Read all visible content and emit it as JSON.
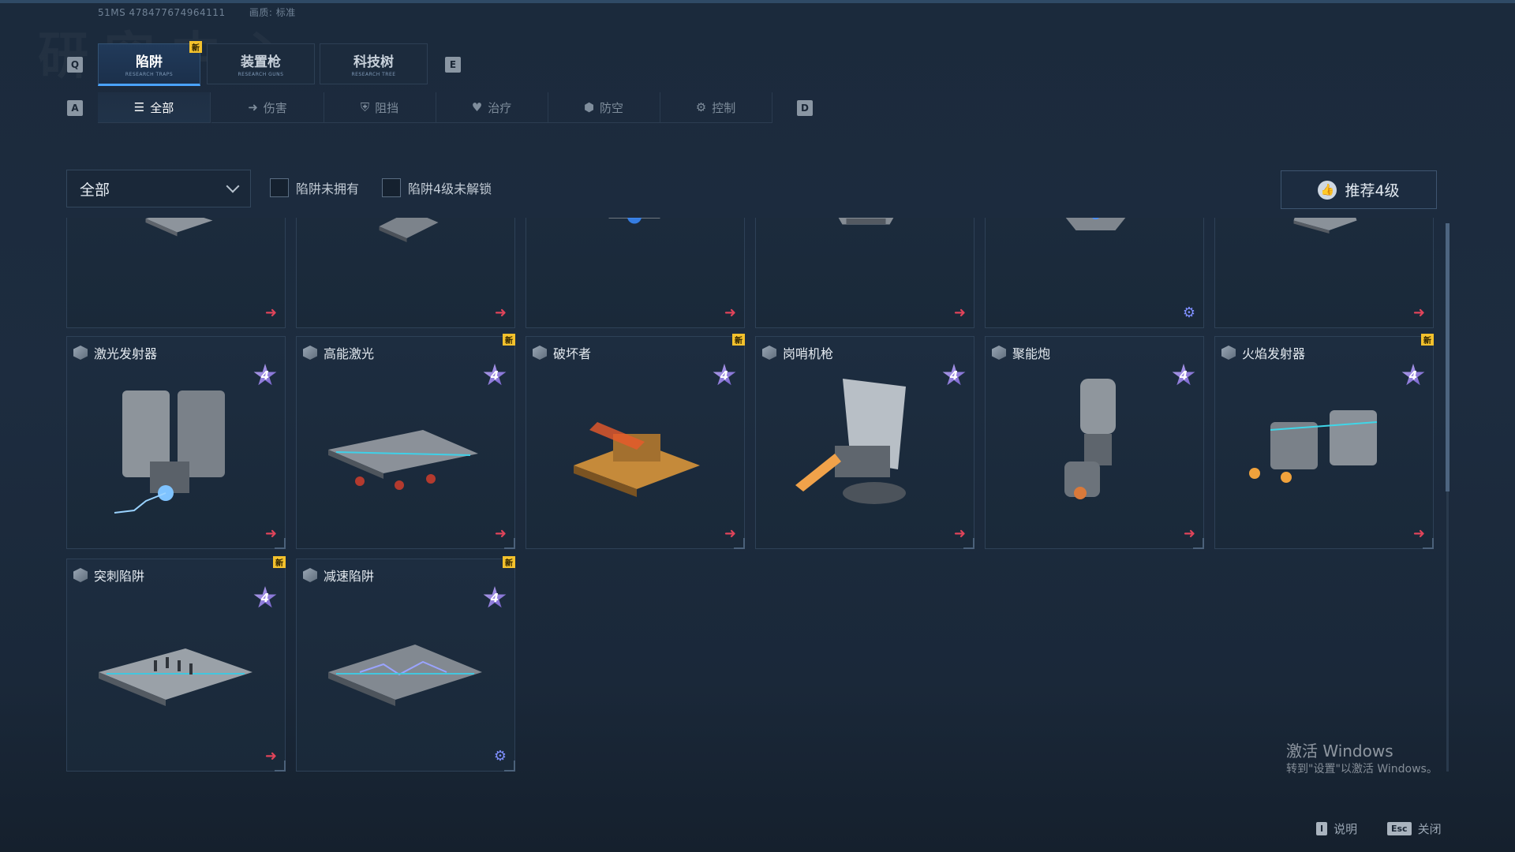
{
  "build_info": {
    "version": "51MS 478477674964111",
    "quality": "画质: 标准"
  },
  "watermark": "研究中心",
  "keys": {
    "prev_main": "Q",
    "next_main": "E",
    "prev_sub": "A",
    "next_sub": "D"
  },
  "main_tabs": [
    {
      "label": "陷阱",
      "sub": "RESEARCH TRAPS",
      "active": true,
      "new": "新"
    },
    {
      "label": "装置枪",
      "sub": "RESEARCH GUNS",
      "active": false
    },
    {
      "label": "科技树",
      "sub": "RESEARCH TREE",
      "active": false
    }
  ],
  "sub_tabs": [
    {
      "label": "全部",
      "icon": "list-icon",
      "active": true
    },
    {
      "label": "伤害",
      "icon": "arrow-right-icon"
    },
    {
      "label": "阻挡",
      "icon": "shield-icon"
    },
    {
      "label": "治疗",
      "icon": "heart-icon"
    },
    {
      "label": "防空",
      "icon": "antiair-icon"
    },
    {
      "label": "控制",
      "icon": "gear-icon"
    }
  ],
  "filters": {
    "dropdown_value": "全部",
    "checkbox_not_owned": "陷阱未拥有",
    "checkbox_lv4_locked": "陷阱4级未解锁",
    "recommend_button": "推荐4级"
  },
  "cards_top_row": [
    {
      "action": "arrow"
    },
    {
      "action": "arrow"
    },
    {
      "action": "arrow"
    },
    {
      "action": "arrow"
    },
    {
      "action": "gear"
    },
    {
      "action": "arrow"
    }
  ],
  "cards": [
    {
      "name": "激光发射器",
      "level": "4",
      "new": "",
      "action": "arrow"
    },
    {
      "name": "高能激光",
      "level": "4",
      "new": "新",
      "action": "arrow"
    },
    {
      "name": "破坏者",
      "level": "4",
      "new": "新",
      "action": "arrow"
    },
    {
      "name": "岗哨机枪",
      "level": "4",
      "new": "",
      "action": "arrow"
    },
    {
      "name": "聚能炮",
      "level": "4",
      "new": "",
      "action": "arrow"
    },
    {
      "name": "火焰发射器",
      "level": "4",
      "new": "新",
      "action": "arrow"
    },
    {
      "name": "突刺陷阱",
      "level": "4",
      "new": "新",
      "action": "arrow"
    },
    {
      "name": "减速陷阱",
      "level": "4",
      "new": "新",
      "action": "gear"
    }
  ],
  "windows_activation": {
    "title": "激活 Windows",
    "sub": "转到\"设置\"以激活 Windows。"
  },
  "footer": {
    "help_key": "I",
    "help_label": "说明",
    "close_key": "Esc",
    "close_label": "关闭"
  }
}
